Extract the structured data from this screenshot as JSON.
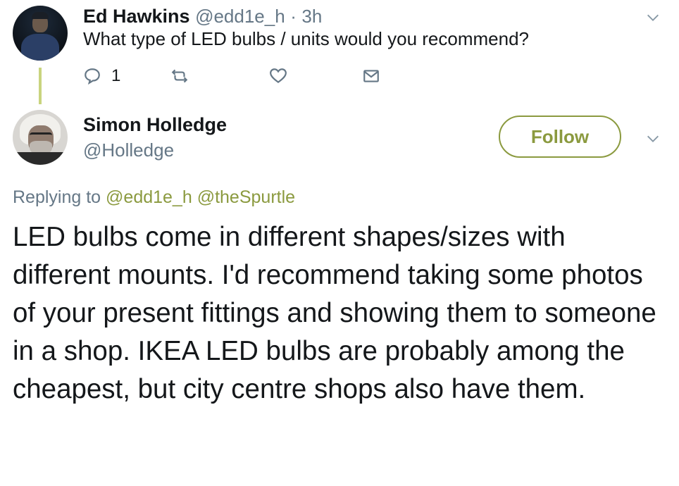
{
  "parent_tweet": {
    "author_name": "Ed Hawkins",
    "author_handle": "@edd1e_h",
    "separator": "·",
    "time": "3h",
    "text": "What type of LED bulbs / units would you recommend?",
    "reply_count": "1",
    "icons": {
      "reply": "reply-icon",
      "retweet": "retweet-icon",
      "like": "heart-icon",
      "dm": "envelope-icon",
      "menu": "chevron-down-icon"
    }
  },
  "tweet": {
    "author_name": "Simon Holledge",
    "author_handle": "@Holledge",
    "follow_label": "Follow",
    "replying_prefix": "Replying to",
    "replying_mentions": [
      "@edd1e_h",
      "@theSpurtle"
    ],
    "text": "LED bulbs come in different shapes/sizes with different mounts. I'd recommend taking some photos of your present fittings and showing them to someone in a shop. IKEA LED bulbs are probably among the cheapest, but city centre shops also have them."
  },
  "colors": {
    "accent": "#8b9a3f",
    "thread_line": "#c9d47e",
    "secondary_text": "#657786"
  }
}
